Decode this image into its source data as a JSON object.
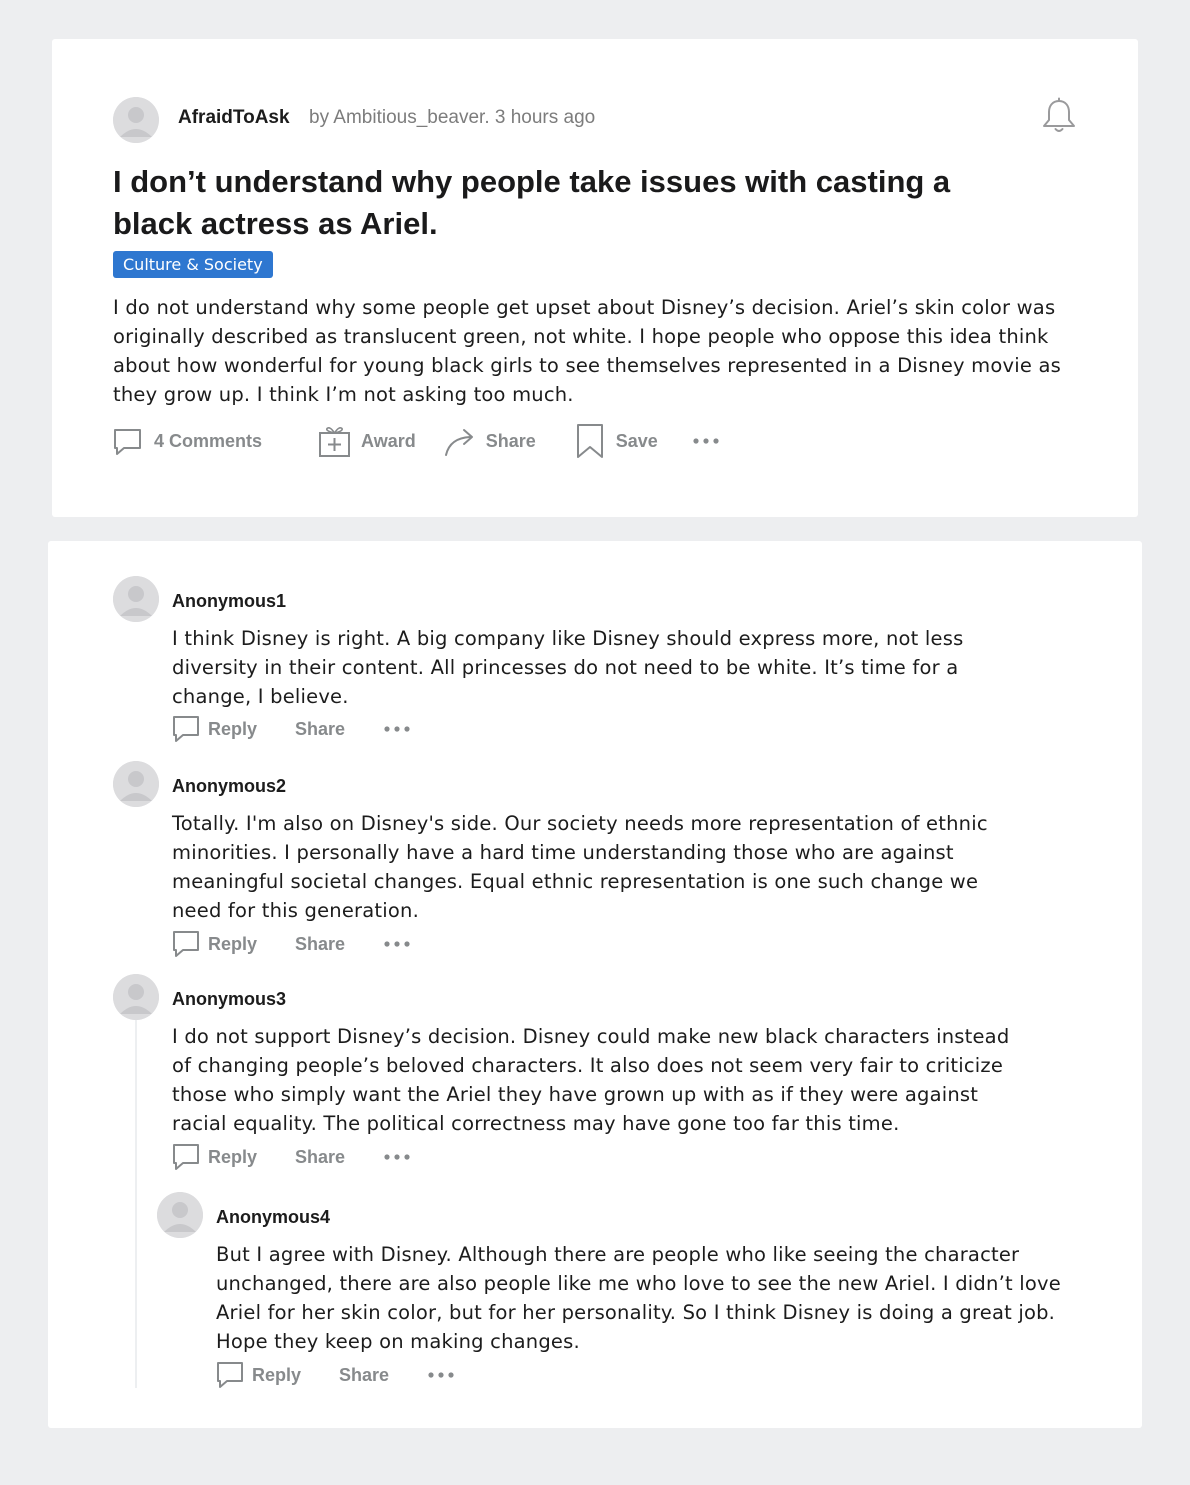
{
  "post": {
    "community": "AfraidToAsk",
    "byline": "by Ambitious_beaver. 3 hours ago",
    "title": "I don’t understand why people take issues with casting a black actress as Ariel.",
    "flair": "Culture & Society",
    "body": "I do not understand why some people get upset about Disney’s decision. Ariel’s skin color was originally described as translucent green, not white. I hope people who oppose this idea think about how wonderful for young black girls to see themselves represented in a Disney movie as they grow up. I think I’m not asking too much.",
    "actions": {
      "comments": "4 Comments",
      "award": "Award",
      "share": "Share",
      "save": "Save"
    }
  },
  "comments": [
    {
      "author": "Anonymous1",
      "body": "I think Disney is right. A big company like Disney should express more, not less diversity in their content. All princesses do not need to be white. It’s time for a change, I believe.",
      "reply": "Reply",
      "share": "Share"
    },
    {
      "author": "Anonymous2",
      "body": "Totally. I'm also on Disney's side. Our society needs more representation of ethnic minorities. I personally have a hard time understanding those who are against meaningful societal changes. Equal ethnic representation is one such change we need for this generation.",
      "reply": "Reply",
      "share": "Share"
    },
    {
      "author": "Anonymous3",
      "body": "I do not support Disney’s decision. Disney could make new black characters instead of changing people’s beloved characters. It also does not seem very fair to criticize those who simply want the Ariel they have grown up with as if they were against racial equality. The political correctness may have gone too far this time.",
      "reply": "Reply",
      "share": "Share"
    },
    {
      "author": "Anonymous4",
      "body": "But I agree with Disney. Although there are people who like seeing the character unchanged, there are also people like me who love to see the new Ariel. I didn’t love Ariel for her skin color, but for her personality. So I think Disney is doing a great job. Hope they keep on making changes.",
      "reply": "Reply",
      "share": "Share"
    }
  ],
  "icons": {
    "avatar": "user-avatar-icon",
    "bell": "bell-icon",
    "comment": "comment-bubble-icon",
    "award": "gift-icon",
    "share": "share-arrow-icon",
    "save": "bookmark-icon",
    "more": "more-dots-icon"
  },
  "colors": {
    "background": "#edeef0",
    "card": "#ffffff",
    "flair": "#2e77d0",
    "muted": "#878a8c",
    "text": "#1c1c1c"
  }
}
